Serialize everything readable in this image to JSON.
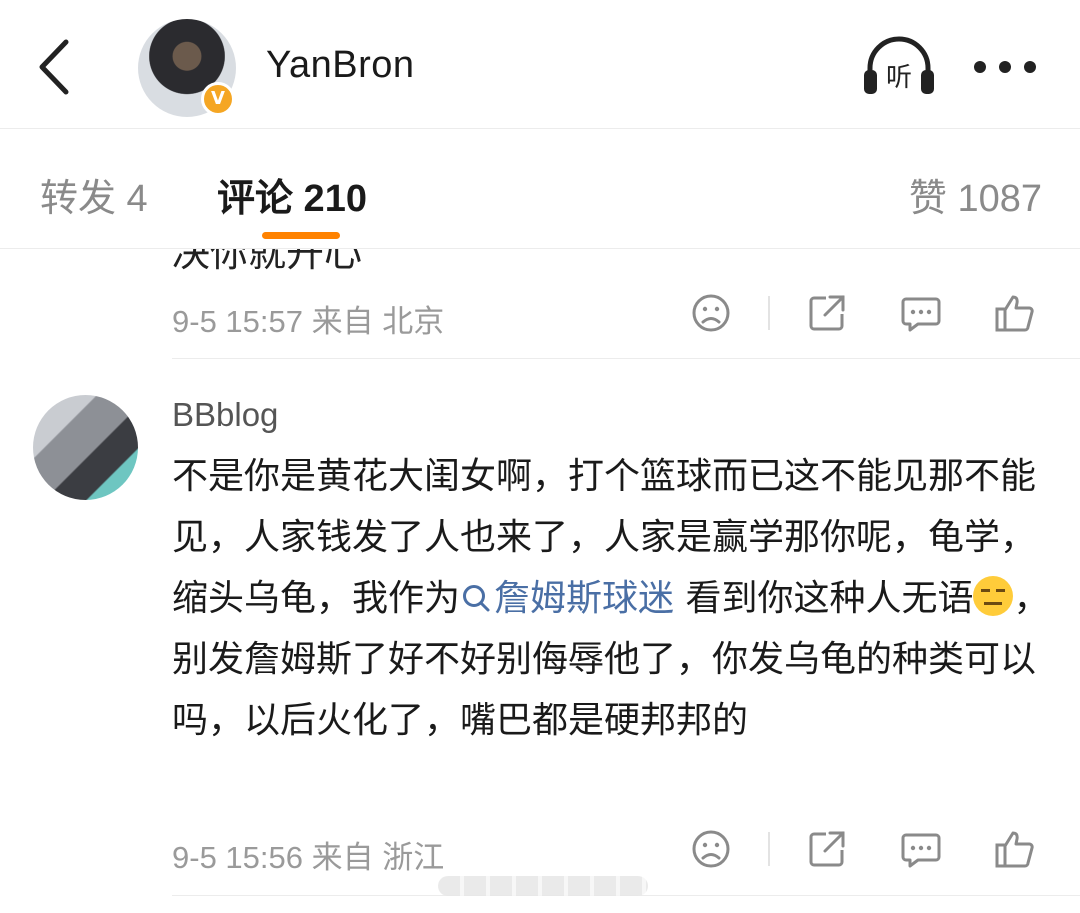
{
  "header": {
    "username": "YanBron",
    "verified_badge": "V",
    "back_icon": "chevron-left-icon",
    "listen_icon": "headphones-icon",
    "listen_label": "听",
    "more_icon": "more-dots-icon"
  },
  "tabs": {
    "repost": "转发 4",
    "comments": "评论 210",
    "likes": "赞 1087",
    "active": "comments",
    "accent_color": "#ff8200"
  },
  "previous_comment": {
    "partial_text": "决你就开心",
    "meta": "9-5 15:57  来自 北京"
  },
  "comment": {
    "author": "BBblog",
    "text_before_link": "不是你是黄花大闺女啊，打个篮球而已这不能见那不能见，人家钱发了人也来了，人家是赢学那你呢，龟学，缩头乌龟，我作为",
    "topic_link": "詹姆斯球迷",
    "text_middle": " 看到你这种人无语",
    "text_after_emoji": "，别发詹姆斯了好不好别侮辱他了，你发乌龟的种类可以吗，以后火化了，嘴巴都是硬邦邦的",
    "meta": "9-5 15:56  来自 浙江"
  },
  "action_icons": [
    "dislike-face-icon",
    "share-icon",
    "comment-icon",
    "like-thumb-icon"
  ]
}
